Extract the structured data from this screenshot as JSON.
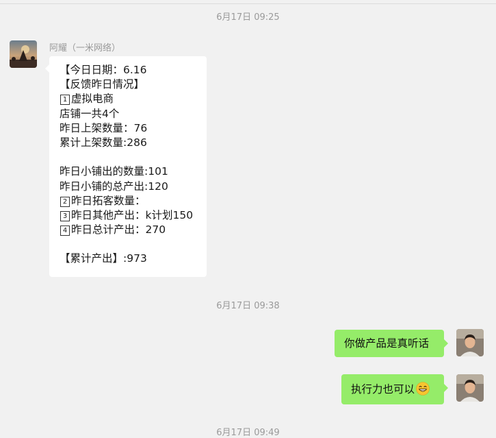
{
  "timestamps": [
    "6月17日 09:25",
    "6月17日 09:38",
    "6月17日 09:49"
  ],
  "incoming": {
    "sender": "阿耀（一米网络）",
    "lines": [
      {
        "num": "",
        "text": "【今日日期：6.16"
      },
      {
        "num": "",
        "text": "【反馈昨日情况】"
      },
      {
        "num": "1",
        "text": "虚拟电商"
      },
      {
        "num": "",
        "text": "店铺一共4个"
      },
      {
        "num": "",
        "text": "昨日上架数量：76"
      },
      {
        "num": "",
        "text": "累计上架数量:286"
      },
      {
        "num": "",
        "text": ""
      },
      {
        "num": "",
        "text": "昨日小铺出的数量:101"
      },
      {
        "num": "",
        "text": "昨日小铺的总产出:120"
      },
      {
        "num": "2",
        "text": "昨日拓客数量："
      },
      {
        "num": "3",
        "text": "昨日其他产出：k计划150"
      },
      {
        "num": "4",
        "text": "昨日总计产出：270"
      },
      {
        "num": "",
        "text": ""
      },
      {
        "num": "",
        "text": "【累计产出】:973"
      }
    ]
  },
  "outgoing": [
    {
      "text": "你做产品是真听话",
      "emoji": ""
    },
    {
      "text": "执行力也可以",
      "emoji": "grin-emoji"
    }
  ],
  "colors": {
    "background": "#f1f1f1",
    "incoming_bubble": "#ffffff",
    "outgoing_bubble": "#95ec69",
    "timestamp": "#9a9a9a"
  }
}
